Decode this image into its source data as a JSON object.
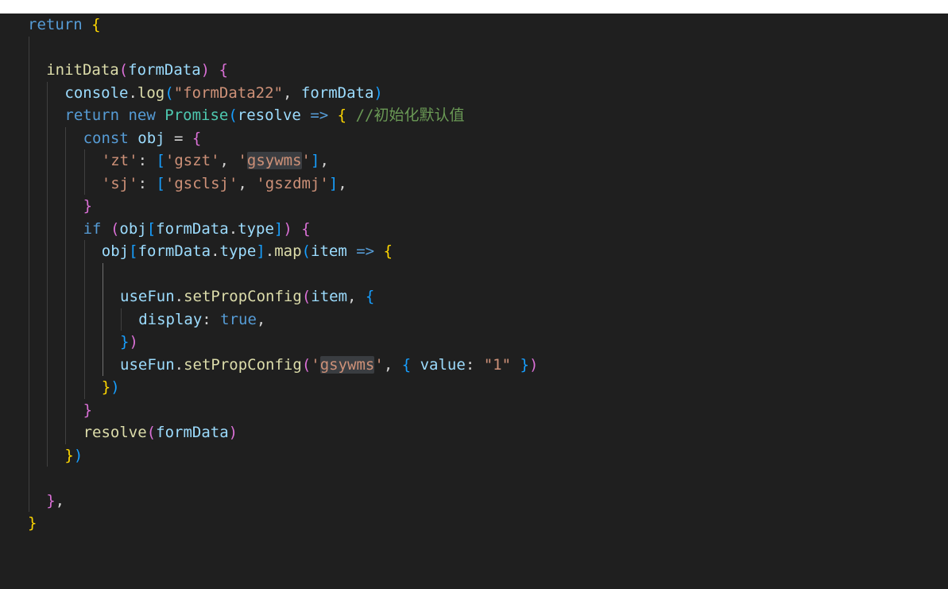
{
  "editor": {
    "language": "javascript",
    "lines": [
      {
        "indent": 0,
        "tokens": [
          [
            "kw",
            "return"
          ],
          [
            "plain",
            " "
          ],
          [
            "b1",
            "{"
          ]
        ]
      },
      {
        "indent": 1,
        "tokens": []
      },
      {
        "indent": 1,
        "tokens": [
          [
            "fn",
            "initData"
          ],
          [
            "b2",
            "("
          ],
          [
            "var",
            "formData"
          ],
          [
            "b2",
            ")"
          ],
          [
            "plain",
            " "
          ],
          [
            "b2",
            "{"
          ]
        ]
      },
      {
        "indent": 2,
        "tokens": [
          [
            "var",
            "console"
          ],
          [
            "plain",
            "."
          ],
          [
            "fn",
            "log"
          ],
          [
            "b3",
            "("
          ],
          [
            "str",
            "\"formData22\""
          ],
          [
            "plain",
            ", "
          ],
          [
            "var",
            "formData"
          ],
          [
            "b3",
            ")"
          ]
        ]
      },
      {
        "indent": 2,
        "tokens": [
          [
            "ctl",
            "return"
          ],
          [
            "plain",
            " "
          ],
          [
            "kw",
            "new"
          ],
          [
            "plain",
            " "
          ],
          [
            "cls",
            "Promise"
          ],
          [
            "b3",
            "("
          ],
          [
            "var",
            "resolve"
          ],
          [
            "plain",
            " "
          ],
          [
            "kw",
            "=>"
          ],
          [
            "plain",
            " "
          ],
          [
            "b1",
            "{"
          ],
          [
            "plain",
            " "
          ],
          [
            "cmt",
            "//初始化默认值"
          ]
        ]
      },
      {
        "indent": 3,
        "tokens": [
          [
            "kw",
            "const"
          ],
          [
            "plain",
            " "
          ],
          [
            "var",
            "obj"
          ],
          [
            "plain",
            " = "
          ],
          [
            "b2",
            "{"
          ]
        ]
      },
      {
        "indent": 4,
        "tokens": [
          [
            "str",
            "'zt'"
          ],
          [
            "plain",
            ": "
          ],
          [
            "b3",
            "["
          ],
          [
            "str",
            "'gszt'"
          ],
          [
            "plain",
            ", "
          ],
          [
            "str",
            "'"
          ],
          [
            "str hl",
            "gsywms"
          ],
          [
            "str",
            "'"
          ],
          [
            "b3",
            "]"
          ],
          [
            "plain",
            ","
          ]
        ]
      },
      {
        "indent": 4,
        "tokens": [
          [
            "str",
            "'sj'"
          ],
          [
            "plain",
            ": "
          ],
          [
            "b3",
            "["
          ],
          [
            "str",
            "'gsclsj'"
          ],
          [
            "plain",
            ", "
          ],
          [
            "str",
            "'gszdmj'"
          ],
          [
            "b3",
            "]"
          ],
          [
            "plain",
            ","
          ]
        ]
      },
      {
        "indent": 3,
        "tokens": [
          [
            "b2",
            "}"
          ]
        ]
      },
      {
        "indent": 3,
        "tokens": [
          [
            "ctl",
            "if"
          ],
          [
            "plain",
            " "
          ],
          [
            "b2",
            "("
          ],
          [
            "var",
            "obj"
          ],
          [
            "b3",
            "["
          ],
          [
            "var",
            "formData"
          ],
          [
            "plain",
            "."
          ],
          [
            "var",
            "type"
          ],
          [
            "b3",
            "]"
          ],
          [
            "b2",
            ")"
          ],
          [
            "plain",
            " "
          ],
          [
            "b2",
            "{"
          ]
        ]
      },
      {
        "indent": 4,
        "tokens": [
          [
            "var",
            "obj"
          ],
          [
            "b3",
            "["
          ],
          [
            "var",
            "formData"
          ],
          [
            "plain",
            "."
          ],
          [
            "var",
            "type"
          ],
          [
            "b3",
            "]"
          ],
          [
            "plain",
            "."
          ],
          [
            "fn",
            "map"
          ],
          [
            "b3",
            "("
          ],
          [
            "var",
            "item"
          ],
          [
            "plain",
            " "
          ],
          [
            "kw",
            "=>"
          ],
          [
            "plain",
            " "
          ],
          [
            "b1",
            "{"
          ]
        ]
      },
      {
        "indent": 5,
        "tokens": []
      },
      {
        "indent": 5,
        "tokens": [
          [
            "var",
            "useFun"
          ],
          [
            "plain",
            "."
          ],
          [
            "fn",
            "setPropConfig"
          ],
          [
            "b2",
            "("
          ],
          [
            "var",
            "item"
          ],
          [
            "plain",
            ", "
          ],
          [
            "b3",
            "{"
          ]
        ]
      },
      {
        "indent": 6,
        "tokens": [
          [
            "var",
            "display"
          ],
          [
            "plain",
            ": "
          ],
          [
            "kw",
            "true"
          ],
          [
            "plain",
            ","
          ]
        ]
      },
      {
        "indent": 5,
        "tokens": [
          [
            "b3",
            "}"
          ],
          [
            "b2",
            ")"
          ]
        ]
      },
      {
        "indent": 5,
        "tokens": [
          [
            "var",
            "useFun"
          ],
          [
            "plain",
            "."
          ],
          [
            "fn",
            "setPropConfig"
          ],
          [
            "b2",
            "("
          ],
          [
            "str",
            "'"
          ],
          [
            "str hl",
            "gsywms"
          ],
          [
            "str",
            "'"
          ],
          [
            "plain",
            ", "
          ],
          [
            "b3",
            "{"
          ],
          [
            "plain",
            " "
          ],
          [
            "var",
            "value"
          ],
          [
            "plain",
            ": "
          ],
          [
            "str",
            "\"1\""
          ],
          [
            "plain",
            " "
          ],
          [
            "b3",
            "}"
          ],
          [
            "b2",
            ")"
          ]
        ]
      },
      {
        "indent": 4,
        "tokens": [
          [
            "b1",
            "}"
          ],
          [
            "b3",
            ")"
          ]
        ]
      },
      {
        "indent": 3,
        "tokens": [
          [
            "b2",
            "}"
          ]
        ]
      },
      {
        "indent": 3,
        "tokens": [
          [
            "fn",
            "resolve"
          ],
          [
            "b2",
            "("
          ],
          [
            "var",
            "formData"
          ],
          [
            "b2",
            ")"
          ]
        ]
      },
      {
        "indent": 2,
        "tokens": [
          [
            "b1",
            "}"
          ],
          [
            "b3",
            ")"
          ]
        ]
      },
      {
        "indent": 1,
        "tokens": []
      },
      {
        "indent": 1,
        "tokens": [
          [
            "b2",
            "}"
          ],
          [
            "plain",
            ","
          ]
        ]
      },
      {
        "indent": 0,
        "tokens": [
          [
            "b1",
            "}"
          ]
        ]
      }
    ]
  }
}
